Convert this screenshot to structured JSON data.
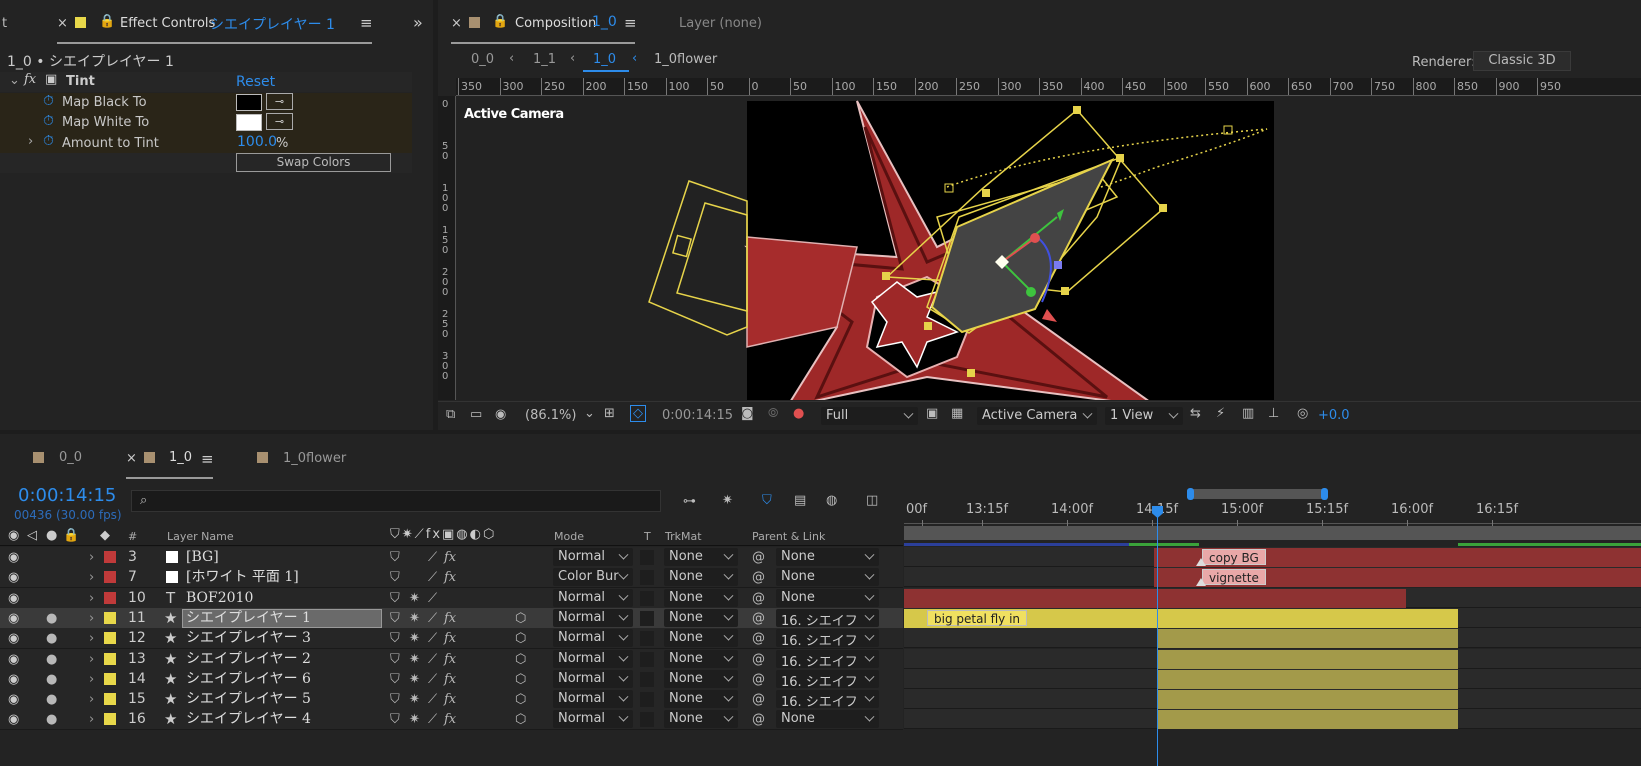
{
  "effect_panel": {
    "tab_label": "Effect Controls",
    "tab_layer": "シエイプレイヤー 1",
    "subtitle": "1_0 • シエイプレイヤー 1",
    "effect_name": "Tint",
    "reset": "Reset",
    "params": [
      {
        "name": "Map Black To"
      },
      {
        "name": "Map White To"
      },
      {
        "name": "Amount to Tint",
        "value": "100.0",
        "unit": "%"
      }
    ],
    "swap": "Swap Colors",
    "colors": {
      "black": "#000000",
      "white": "#ffffff"
    }
  },
  "comp_panel": {
    "tab_label": "Composition",
    "tab_name": "1_0",
    "layer_tab": "Layer  (none)",
    "breadcrumbs": [
      "0_0",
      "1_1",
      "1_0",
      "1_0flower"
    ],
    "renderer_label": "Renderer:",
    "renderer_value": "Classic 3D",
    "ruler_ticks": [
      "350",
      "300",
      "250",
      "200",
      "150",
      "100",
      "50",
      "0",
      "50",
      "100",
      "150",
      "200",
      "250",
      "300",
      "350",
      "400",
      "450",
      "500",
      "550",
      "600",
      "650",
      "700",
      "750",
      "800",
      "850",
      "900",
      "950"
    ],
    "active_camera": "Active Camera",
    "toolbar": {
      "zoom": "(86.1%)",
      "timecode": "0:00:14:15",
      "resolution": "Full",
      "camera": "Active Camera",
      "views": "1 View",
      "exposure": "+0.0"
    }
  },
  "timeline": {
    "tabs": [
      {
        "label": "0_0"
      },
      {
        "label": "1_0"
      },
      {
        "label": "1_0flower"
      }
    ],
    "timecode": "0:00:14:15",
    "frames": "00436 (30.00 fps)",
    "search_placeholder": "",
    "headers": {
      "num": "#",
      "layer_name": "Layer Name",
      "mode": "Mode",
      "t": "T",
      "trkmat": "TrkMat",
      "parent": "Parent & Link"
    },
    "ruler_labels": [
      "00f",
      "13:15f",
      "14:00f",
      "14:15f",
      "15:00f",
      "15:15f",
      "16:00f",
      "16:15f"
    ],
    "layers": [
      {
        "num": "3",
        "chip": "#c03a3a",
        "type": "solid",
        "name": "[BG]",
        "mode": "Normal",
        "trkmat": "None",
        "parent": "None",
        "selected": false
      },
      {
        "num": "7",
        "chip": "#c03a3a",
        "type": "solid",
        "name": "[ホワイト 平面 1]",
        "mode": "Color Bur",
        "trkmat": "None",
        "parent": "None",
        "selected": false
      },
      {
        "num": "10",
        "chip": "#c03a3a",
        "type": "text",
        "name": "BOF2010",
        "mode": "Normal",
        "trkmat": "None",
        "parent": "None",
        "selected": false
      },
      {
        "num": "11",
        "chip": "#e8d84a",
        "type": "shape",
        "name": "シエイプレイヤー 1",
        "mode": "Normal",
        "trkmat": "None",
        "parent": "16. シエイフ",
        "selected": true
      },
      {
        "num": "12",
        "chip": "#e8d84a",
        "type": "shape",
        "name": "シエイプレイヤー 3",
        "mode": "Normal",
        "trkmat": "None",
        "parent": "16. シエイフ",
        "selected": false
      },
      {
        "num": "13",
        "chip": "#e8d84a",
        "type": "shape",
        "name": "シエイプレイヤー 2",
        "mode": "Normal",
        "trkmat": "None",
        "parent": "16. シエイフ",
        "selected": false
      },
      {
        "num": "14",
        "chip": "#e8d84a",
        "type": "shape",
        "name": "シエイプレイヤー 6",
        "mode": "Normal",
        "trkmat": "None",
        "parent": "16. シエイフ",
        "selected": false
      },
      {
        "num": "15",
        "chip": "#e8d84a",
        "type": "shape",
        "name": "シエイプレイヤー 5",
        "mode": "Normal",
        "trkmat": "None",
        "parent": "16. シエイフ",
        "selected": false
      },
      {
        "num": "16",
        "chip": "#e8d84a",
        "type": "shape",
        "name": "シエイプレイヤー 4",
        "mode": "Normal",
        "trkmat": "None",
        "parent": "None",
        "selected": false
      }
    ],
    "markers": {
      "copy_bg": "copy BG",
      "vignette": "vignette",
      "petal": "big petal fly in"
    }
  },
  "colors": {
    "accent": "#2d8ceb",
    "layer_red": "#c03a3a",
    "layer_yellow": "#e8d84a"
  }
}
